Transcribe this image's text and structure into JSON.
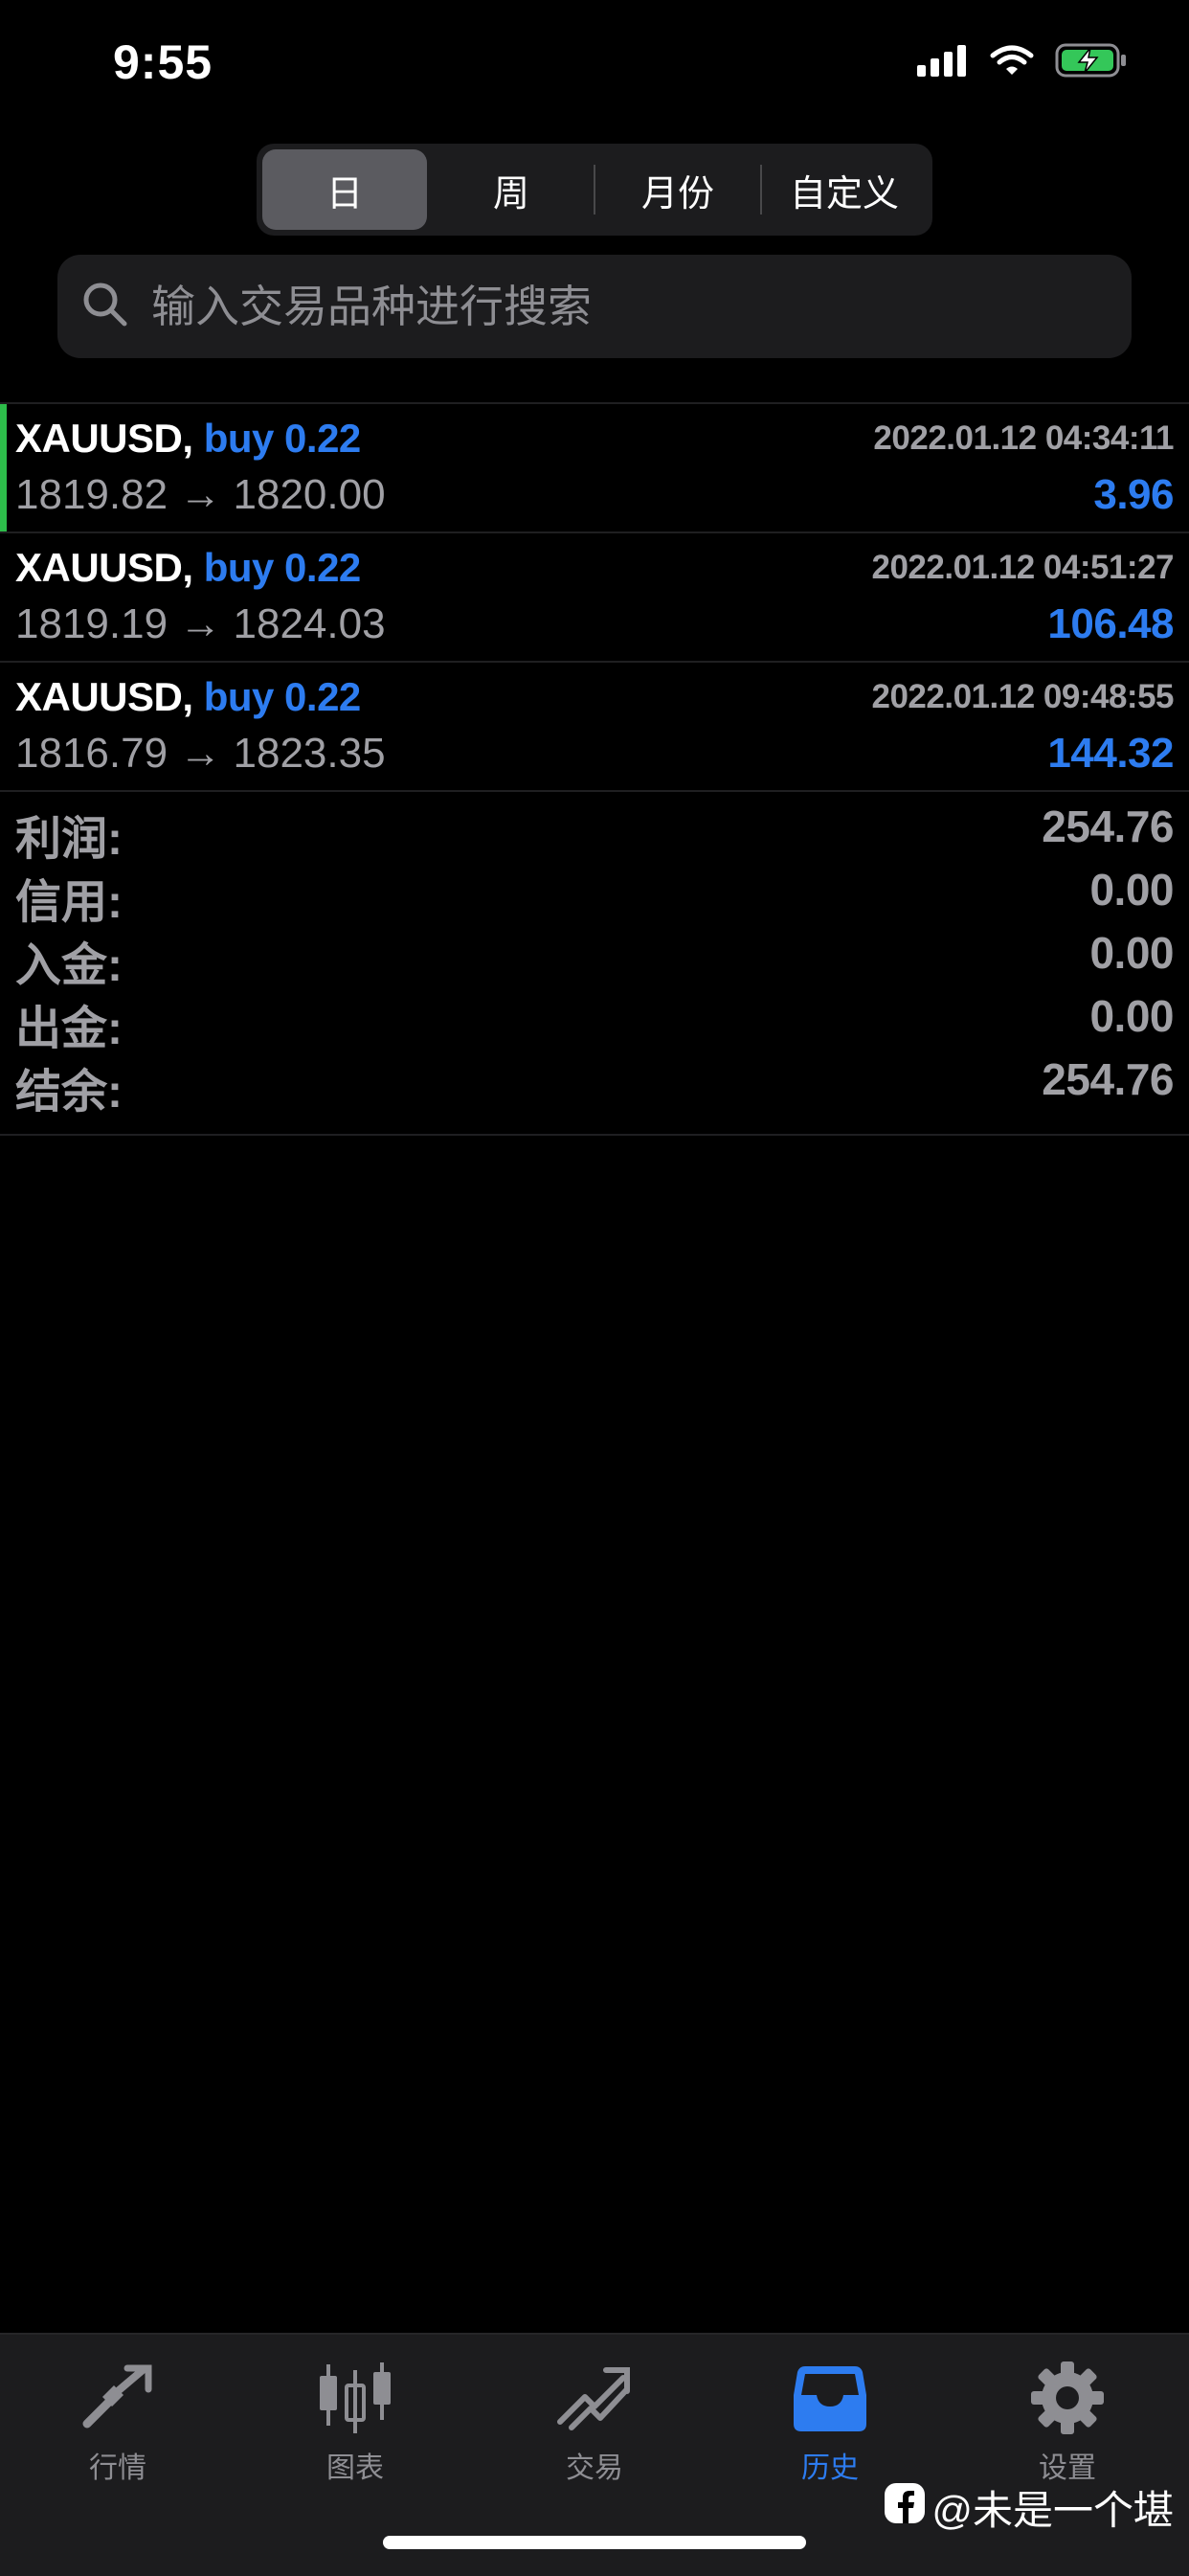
{
  "status_bar": {
    "time": "9:55"
  },
  "period_tabs": [
    {
      "label": "日",
      "active": true
    },
    {
      "label": "周",
      "active": false
    },
    {
      "label": "月份",
      "active": false
    },
    {
      "label": "自定义",
      "active": false
    }
  ],
  "search": {
    "placeholder": "输入交易品种进行搜索",
    "value": ""
  },
  "deals": [
    {
      "symbol": "XAUUSD,",
      "side": "buy 0.22",
      "time": "2022.01.12 04:34:11",
      "prices": "1819.82 → 1820.00",
      "profit": "3.96"
    },
    {
      "symbol": "XAUUSD,",
      "side": "buy 0.22",
      "time": "2022.01.12 04:51:27",
      "prices": "1819.19 → 1824.03",
      "profit": "106.48"
    },
    {
      "symbol": "XAUUSD,",
      "side": "buy 0.22",
      "time": "2022.01.12 09:48:55",
      "prices": "1816.79 → 1823.35",
      "profit": "144.32"
    }
  ],
  "summary": [
    {
      "label": "利润:",
      "value": "254.76"
    },
    {
      "label": "信用:",
      "value": "0.00"
    },
    {
      "label": "入金:",
      "value": "0.00"
    },
    {
      "label": "出金:",
      "value": "0.00"
    },
    {
      "label": "结余:",
      "value": "254.76"
    }
  ],
  "tab_bar": [
    {
      "label": "行情",
      "icon": "quotes-icon",
      "active": false
    },
    {
      "label": "图表",
      "icon": "candlestick-chart-icon",
      "active": false
    },
    {
      "label": "交易",
      "icon": "trade-icon",
      "active": false
    },
    {
      "label": "历史",
      "icon": "history-inbox-icon",
      "active": true
    },
    {
      "label": "设置",
      "icon": "gear-icon",
      "active": false
    }
  ],
  "watermark": {
    "text": "@未是一个堪"
  },
  "colors": {
    "accent": "#2d7cf0",
    "selected_marker": "#2dbd4a",
    "muted_text": "#a0a0a5",
    "background": "#000000"
  }
}
